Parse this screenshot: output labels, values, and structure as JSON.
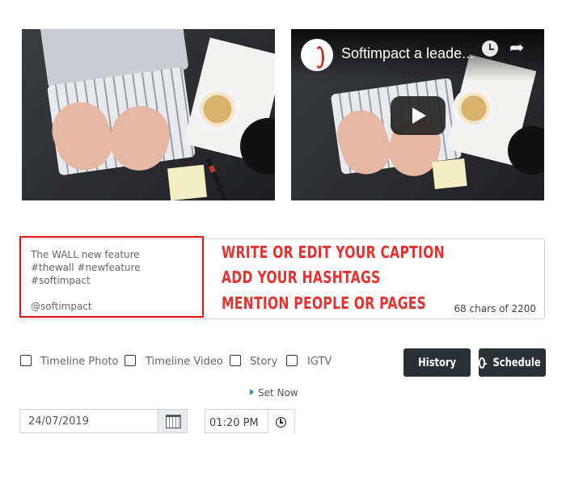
{
  "media": {
    "photo": {
      "icon": "laptop-desk-photo"
    },
    "video": {
      "title": "Softimpact a leade...",
      "logo_icon": "softimpact-logo-icon",
      "play_icon": "play-icon"
    }
  },
  "caption": {
    "text": "The WALL new feature\n#thewall #newfeature #softimpact\n\n@softimpact",
    "char_count": "68 chars of 2200",
    "annotations": [
      "WRITE OR EDIT YOUR CAPTION",
      "ADD YOUR HASHTAGS",
      "MENTION PEOPLE OR PAGES"
    ]
  },
  "post_types": [
    {
      "label": "Timeline Photo",
      "checked": false
    },
    {
      "label": "Timeline Video",
      "checked": false
    },
    {
      "label": "Story",
      "checked": false
    },
    {
      "label": "IGTV",
      "checked": false
    }
  ],
  "buttons": {
    "history": "History",
    "schedule": "Schedule"
  },
  "schedule": {
    "set_now": "Set Now",
    "date": "24/07/2019",
    "time": "01:20 PM"
  },
  "colors": {
    "annotation": "#e8302e",
    "highlight_border": "#e01212",
    "button_bg": "#2b3035",
    "link_arrow": "#2a86c8"
  }
}
